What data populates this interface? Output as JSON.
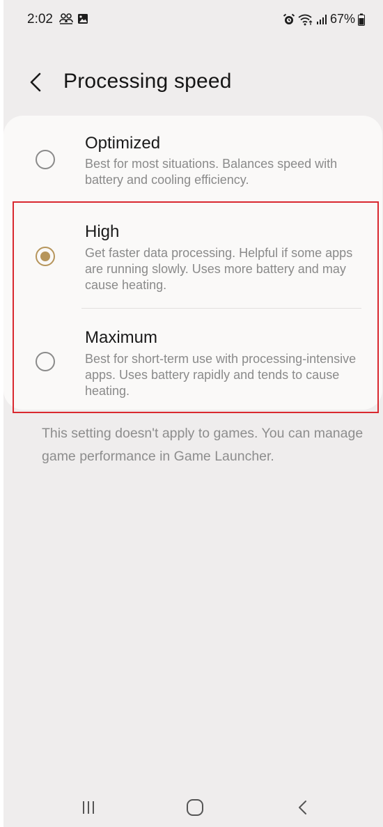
{
  "status_bar": {
    "time": "2:02",
    "battery": "67%",
    "icons": [
      "people-icon",
      "image-icon",
      "alarm-icon",
      "wifi-icon",
      "signal-icon",
      "battery-icon"
    ]
  },
  "header": {
    "title": "Processing speed",
    "back_icon": "chevron-left-icon"
  },
  "options": [
    {
      "title": "Optimized",
      "description": "Best for most situations. Balances speed with battery and cooling efficiency.",
      "selected": false
    },
    {
      "title": "High",
      "description": "Get faster data processing. Helpful if some apps are running slowly. Uses more battery and may cause heating.",
      "selected": true
    },
    {
      "title": "Maximum",
      "description": "Best for short-term use with processing-intensive apps. Uses battery rapidly and tends to cause heating.",
      "selected": false
    }
  ],
  "footnote": "This setting doesn't apply to games. You can manage game performance in Game Launcher.",
  "nav_bar": {
    "buttons": [
      "recents-icon",
      "home-icon",
      "back-icon"
    ]
  },
  "colors": {
    "accent": "#b6955b",
    "highlight": "#d9282f",
    "background": "#efeded",
    "card": "#faf9f8"
  }
}
